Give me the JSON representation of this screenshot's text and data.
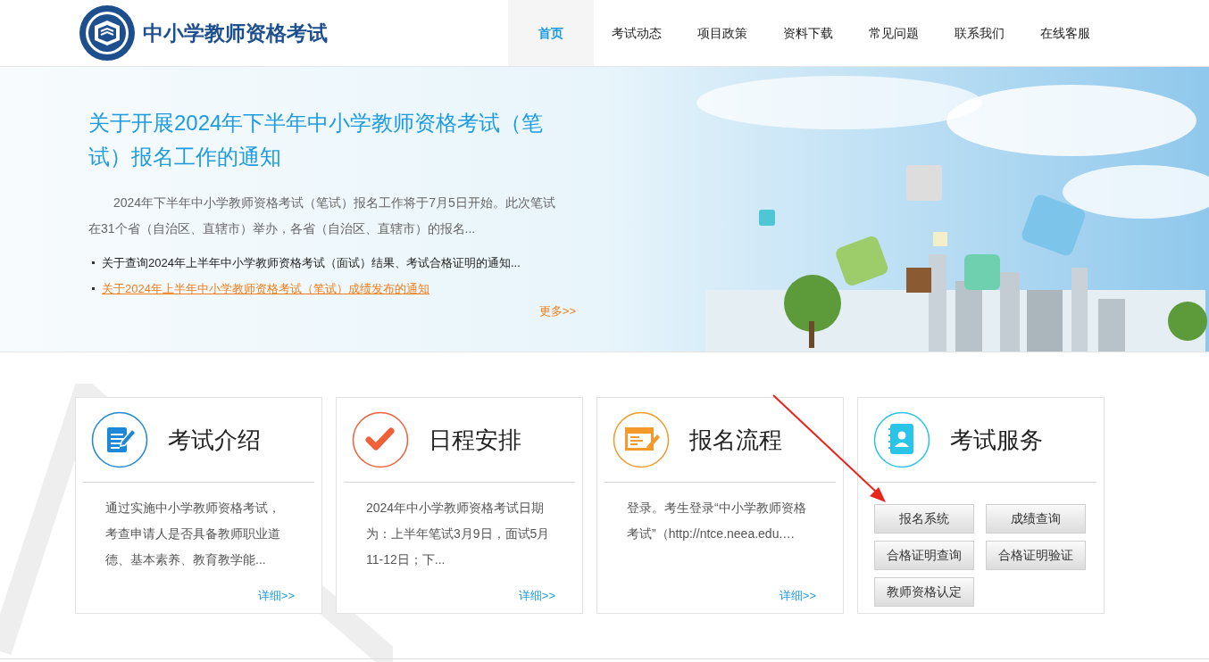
{
  "header": {
    "site_title": "中小学教师资格考试"
  },
  "nav": [
    {
      "label": "首页",
      "selected": true
    },
    {
      "label": "考试动态",
      "selected": false
    },
    {
      "label": "项目政策",
      "selected": false
    },
    {
      "label": "资料下载",
      "selected": false
    },
    {
      "label": "常见问题",
      "selected": false
    },
    {
      "label": "联系我们",
      "selected": false
    },
    {
      "label": "在线客服",
      "selected": false
    }
  ],
  "banner": {
    "headline": "关于开展2024年下半年中小学教师资格考试（笔试）报名工作的通知",
    "summary": "2024年下半年中小学教师资格考试（笔试）报名工作将于7月5日开始。此次笔试在31个省（自治区、直辖市）举办，各省（自治区、直辖市）的报名...",
    "news": [
      {
        "title": "关于查询2024年上半年中小学教师资格考试（面试）结果、考试合格证明的通知...",
        "highlighted": false
      },
      {
        "title": "关于2024年上半年中小学教师资格考试（笔试）成绩发布的通知",
        "highlighted": true
      }
    ],
    "more": "更多>>"
  },
  "cards": [
    {
      "kind": "intro",
      "color": "#1e88d6",
      "title": "考试介绍",
      "text": "通过实施中小学教师资格考试，考查申请人是否具备教师职业道德、基本素养、教育教学能...",
      "more": "详细>>"
    },
    {
      "kind": "schedule",
      "color": "#f0613a",
      "title": "日程安排",
      "text": "2024年中小学教师资格考试日期为：上半年笔试3月9日，面试5月11-12日；下...",
      "more": "详细>>"
    },
    {
      "kind": "process",
      "color": "#f39a2b",
      "title": "报名流程",
      "text": "登录。考生登录“中小学教师资格考试”（http://ntce.neea.edu.…",
      "more": "详细>>"
    },
    {
      "kind": "services",
      "color": "#29c4e8",
      "title": "考试服务",
      "buttons": [
        "报名系统",
        "成绩查询",
        "合格证明查询",
        "合格证明验证",
        "教师资格认定"
      ]
    }
  ]
}
